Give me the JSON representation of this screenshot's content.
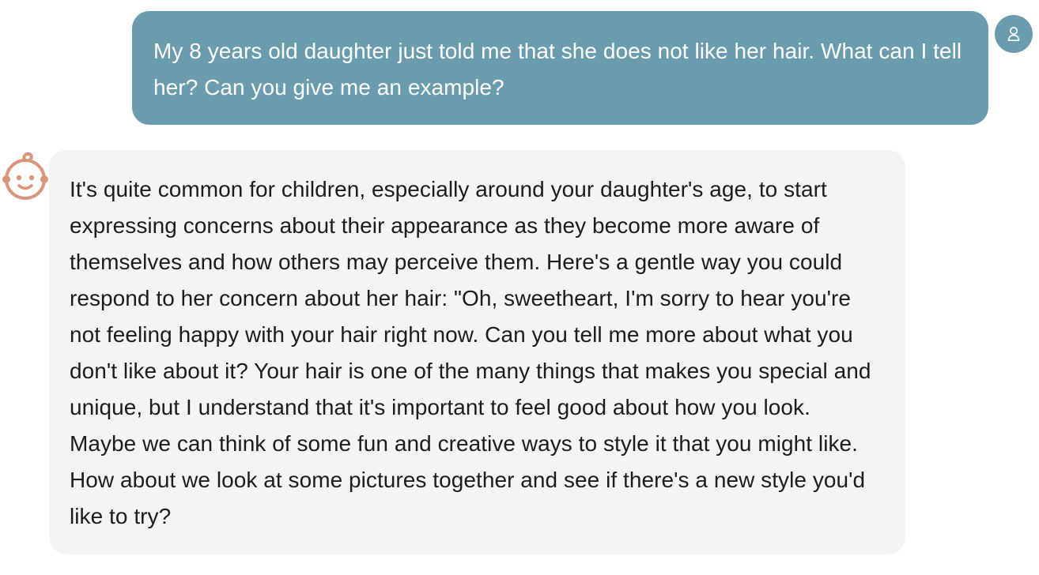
{
  "conversation": {
    "user_message": {
      "text": "My 8 years old daughter just told me that she does not like her hair. What can I tell her? Can you give me an example?",
      "avatar_icon": "user-icon",
      "bubble_color": "#6b9cad",
      "text_color": "#ffffff"
    },
    "assistant_message": {
      "text": "It's quite common for children, especially around your daughter's age, to start expressing concerns about their appearance as they become more aware of themselves and how others may perceive them. Here's a gentle way you could respond to her concern about her hair: \"Oh, sweetheart, I'm sorry to hear you're not feeling happy with your hair right now. Can you tell me more about what you don't like about it? Your hair is one of the many things that makes you special and unique, but I understand that it's important to feel good about how you look. Maybe we can think of some fun and creative ways to style it that you might like. How about we look at some pictures together and see if there's a new style you'd like to try?",
      "avatar_icon": "baby-face-icon",
      "avatar_color": "#d9967c",
      "bubble_color": "#f4f4f4",
      "text_color": "#1c1c1c"
    }
  }
}
